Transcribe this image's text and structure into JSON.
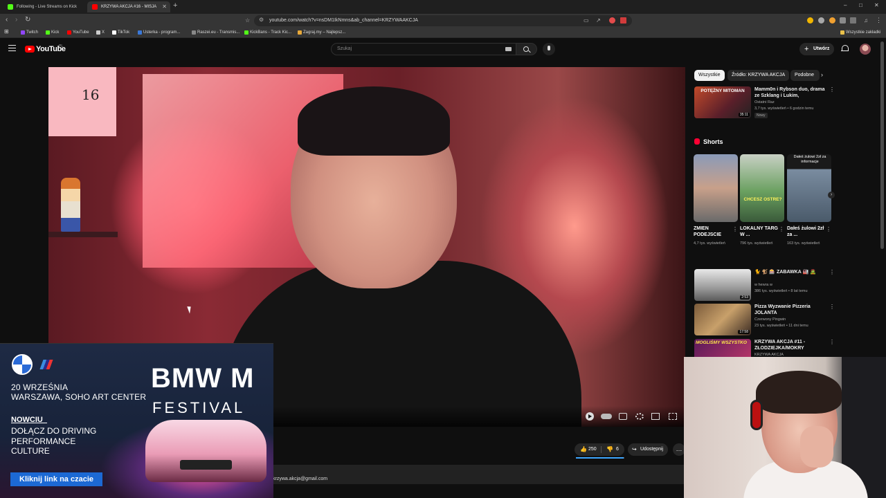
{
  "browser": {
    "tabs": [
      {
        "title": "Following - Live Streams on Kick",
        "active": false,
        "favicon_color": "#53fc18"
      },
      {
        "title": "KRZYWA AKCJA #16 - MISJA",
        "active": true,
        "favicon_color": "#ff0000"
      }
    ],
    "new_tab": "+",
    "window_controls": [
      "–",
      "□",
      "✕"
    ],
    "url": "youtube.com/watch?v=nsDM1IkNmns&ab_channel=KRZYWAAKCJA",
    "bookmarks": [
      {
        "label": "Twitch",
        "color": "#9146ff"
      },
      {
        "label": "Kick",
        "color": "#53fc18"
      },
      {
        "label": "YouTube",
        "color": "#ff0000"
      },
      {
        "label": "X",
        "color": "#cccccc"
      },
      {
        "label": "TikTok",
        "color": "#ffffff"
      },
      {
        "label": "Usterka - program...",
        "color": "#3a78d8"
      },
      {
        "label": "Raszei.eu - Transmis...",
        "color": "#888888"
      },
      {
        "label": "KickBans - Track Kic...",
        "color": "#53fc18"
      },
      {
        "label": "Zagraj.my – Najlepsz...",
        "color": "#e8a93a"
      }
    ],
    "all_bookmarks": "Wszystkie zakładki"
  },
  "youtube": {
    "logo_text": "YouTube",
    "country": "PL",
    "search_placeholder": "Szukaj",
    "create_label": "Utwórz",
    "brand_color": "#ff0000"
  },
  "ad": {
    "m_label": "M",
    "date_line1": "20 WRZEŚNIA",
    "date_line2": "WARSZAWA, SOHO ART CENTER",
    "brand": "BMW M",
    "festival": "FESTIVAL",
    "tag1": "NOWCIU_",
    "tag2": "DOŁĄCZ DO DRIVING PERFORMANCE CULTURE",
    "cta": "Kliknij link na czacie"
  },
  "video": {
    "note_number": "16",
    "likes": "250",
    "dislikes": "6",
    "like_ratio": 0.98,
    "share": "Udostępnij",
    "more": "…",
    "description_email": "krzywa.akcja@gmail.com"
  },
  "sidebar": {
    "chips": [
      "Wszystkie",
      "Źródło: KRZYWA AKCJA",
      "Podobne"
    ],
    "top_rec": {
      "thumb_text": "POTĘŻNY MITOMAN",
      "duration": "35:11",
      "title": "Mamm0n i Rybson duo, drama ze Szklang i Lukim, wyjaśnieni...",
      "channel": "Ostatni Raz",
      "meta": "3,7 tys. wyświetleń • 6 godzin temu",
      "badge": "Nowy"
    },
    "shorts_label": "Shorts",
    "shorts": [
      {
        "title": "ZMIEN PODEJSCIE",
        "views": "4,7 tys. wyświetleń",
        "overlay": ""
      },
      {
        "title": "LOKALNY TARG W ...",
        "views": "796 tys. wyświetleń",
        "overlay": "CHCESZ OSTRE?"
      },
      {
        "title": "Dałeś żulowi 2zł za ...",
        "views": "163 tys. wyświetleń",
        "overlay": "Dałeś żulowi 2zł za informacje"
      }
    ],
    "recs": [
      {
        "title": "🐈 🐒 🎰 ZABAWKA 🏭 🧟",
        "channel": "w hewra w",
        "meta": "386 tys. wyświetleń • 8 lat temu",
        "duration": "2:53"
      },
      {
        "title": "Pizza Wyzwanie Pizzeria JOLANTA",
        "channel": "Czerwony Pingwin",
        "meta": "23 tys. wyświetleń • 11 dni temu",
        "duration": "17:58"
      },
      {
        "title": "KRZYWA AKCJA #11 - ZŁODZIEJKA/MOKRY DYWAN/...",
        "channel": "KRZYWA AKCJA",
        "meta": "",
        "duration": "",
        "thumb_text": "MOGLIŚMY WSZYSTKO"
      }
    ]
  }
}
